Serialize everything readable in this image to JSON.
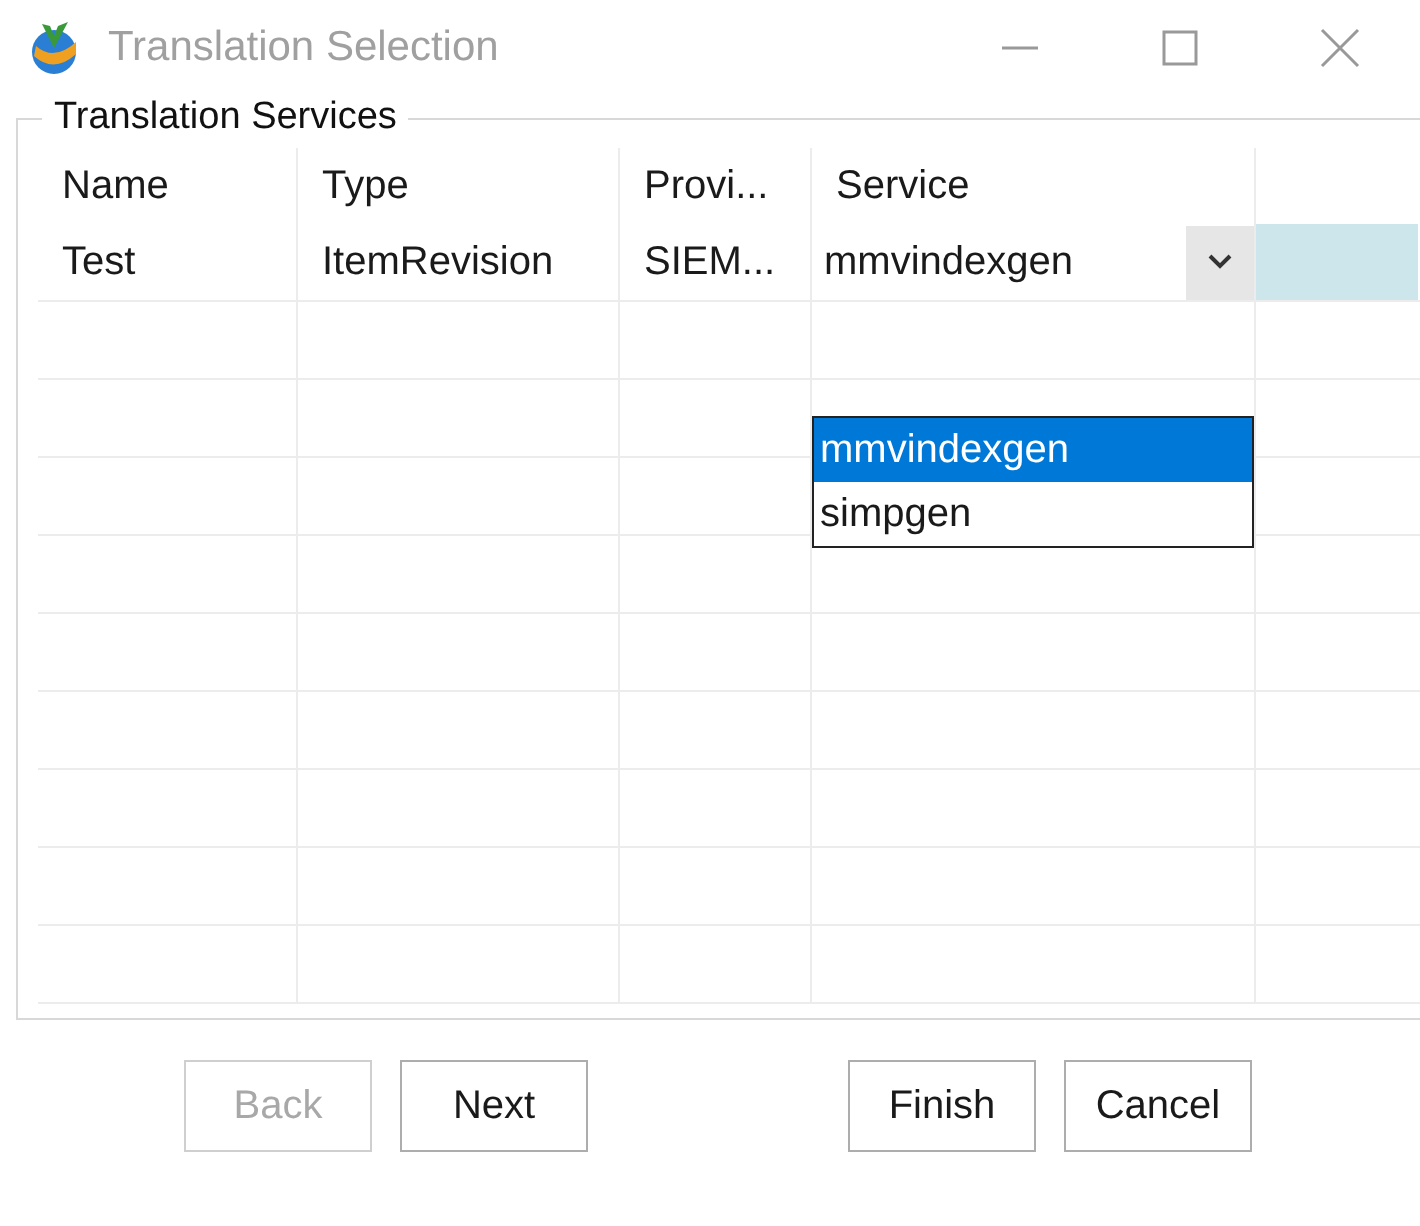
{
  "window": {
    "title": "Translation Selection"
  },
  "group": {
    "title": "Translation Services"
  },
  "table": {
    "columns": [
      "Name",
      "Type",
      "Provi...",
      "Service"
    ],
    "rows": [
      {
        "cells": [
          "Test",
          "ItemRevision",
          "SIEM..."
        ],
        "service": "mmvindexgen",
        "selected": true
      }
    ]
  },
  "service_dropdown": {
    "expanded": true,
    "options": [
      {
        "label": "mmvindexgen",
        "selected": true
      },
      {
        "label": "simpgen",
        "selected": false
      }
    ]
  },
  "buttons": [
    {
      "label": "Back",
      "disabled": true
    },
    {
      "label": "Next",
      "disabled": false
    },
    {
      "label": "Finish",
      "disabled": false
    },
    {
      "label": "Cancel",
      "disabled": false
    }
  ]
}
